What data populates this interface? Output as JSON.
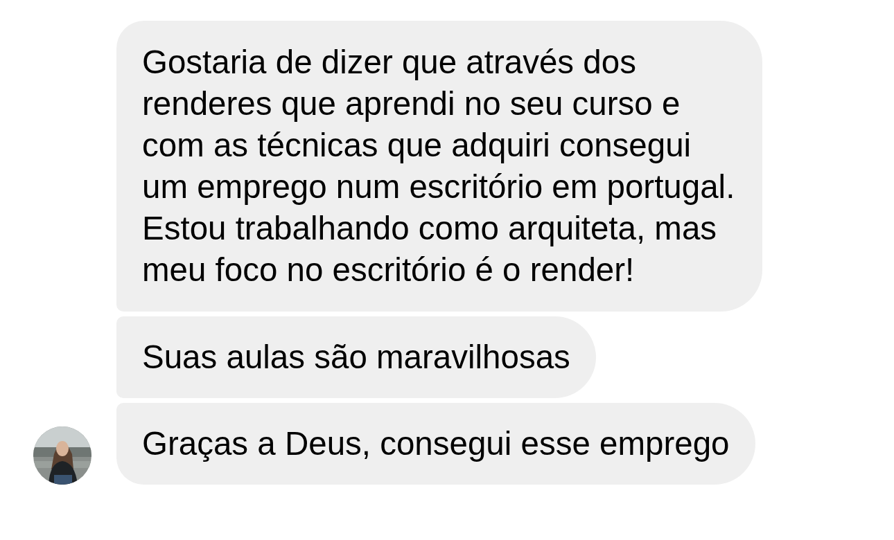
{
  "messages": [
    {
      "text": "Gostaria de dizer que através dos renderes que aprendi no seu curso e com as técnicas que adquiri consegui um emprego num escritório em portugal. Estou trabalhando como arquiteta, mas meu foco no escritório é o render!",
      "avatar": false
    },
    {
      "text": "Suas aulas são maravilhosas",
      "avatar": false
    },
    {
      "text": "Graças a Deus, consegui esse emprego",
      "avatar": true
    }
  ]
}
